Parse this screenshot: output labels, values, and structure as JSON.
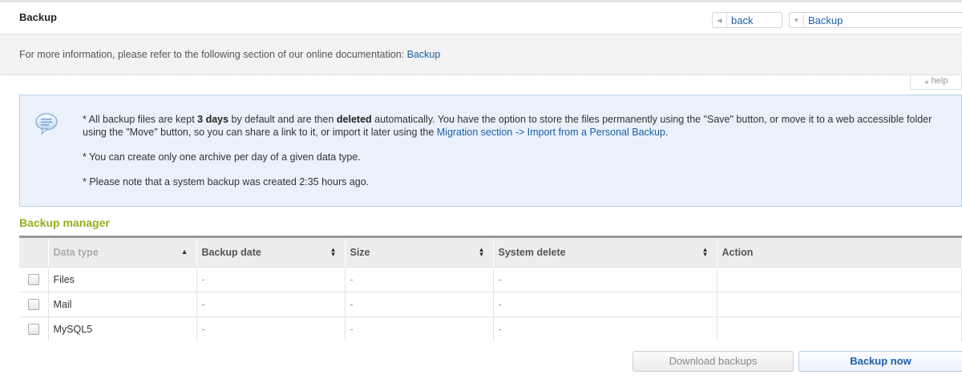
{
  "header": {
    "title": "Backup",
    "back_label": "back",
    "breadcrumb_label": "Backup"
  },
  "docbar": {
    "text": "For more information, please refer to the following section of our online documentation: ",
    "link": "Backup"
  },
  "help": {
    "label": "help"
  },
  "info": {
    "line1_a": "* All backup files are kept ",
    "line1_b": "3 days",
    "line1_c": " by default and are then ",
    "line1_d": "deleted",
    "line1_e": " automatically. You have the option to store the files permanently using the \"Save\" button, or move it to a web accessible folder using the \"Move\" button, so you can share a link to it, or import it later using the ",
    "line1_link": "Migration section -> Import from a Personal Backup",
    "line1_f": ".",
    "line2": "* You can create only one archive per day of a given data type.",
    "line3": "* Please note that a system backup was created 2:35 hours ago."
  },
  "section_title": "Backup manager",
  "table": {
    "columns": [
      "Data type",
      "Backup date",
      "Size",
      "System delete",
      "Action"
    ],
    "rows": [
      {
        "type": "Files",
        "date": "-",
        "size": "-",
        "delete": "-",
        "action": ""
      },
      {
        "type": "Mail",
        "date": "-",
        "size": "-",
        "delete": "-",
        "action": ""
      },
      {
        "type": "MySQL5",
        "date": "-",
        "size": "-",
        "delete": "-",
        "action": ""
      }
    ]
  },
  "buttons": {
    "download": "Download backups",
    "backup_now": "Backup now"
  },
  "colors": {
    "accent_green": "#95ad1a",
    "link_blue": "#1a5fa8",
    "info_bg": "#eaf1fb"
  }
}
